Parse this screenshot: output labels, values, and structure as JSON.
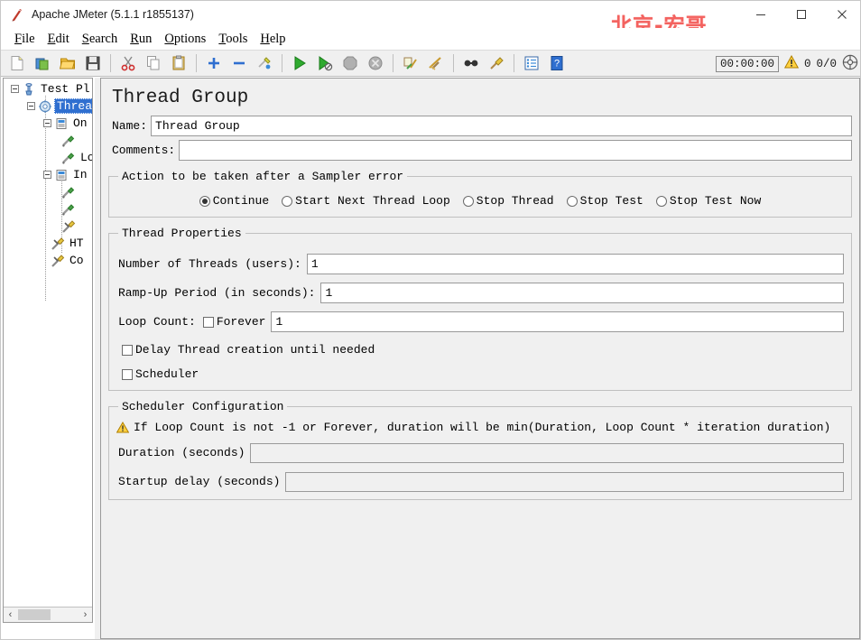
{
  "window": {
    "title": "Apache JMeter (5.1.1 r1855137)",
    "app_icon": "jmeter-feather-icon",
    "watermark": "北京-宏哥",
    "minimize_label": "—",
    "maximize_label": "□",
    "close_label": "✕"
  },
  "menubar": {
    "items": [
      {
        "label": "File",
        "mnemonic": "F"
      },
      {
        "label": "Edit",
        "mnemonic": "E"
      },
      {
        "label": "Search",
        "mnemonic": "S"
      },
      {
        "label": "Run",
        "mnemonic": "R"
      },
      {
        "label": "Options",
        "mnemonic": "O"
      },
      {
        "label": "Tools",
        "mnemonic": "T"
      },
      {
        "label": "Help",
        "mnemonic": "H"
      }
    ]
  },
  "toolbar": {
    "buttons": [
      {
        "name": "new-icon"
      },
      {
        "name": "templates-icon"
      },
      {
        "name": "open-icon"
      },
      {
        "name": "save-icon"
      },
      {
        "name": "separator"
      },
      {
        "name": "cut-icon"
      },
      {
        "name": "copy-icon"
      },
      {
        "name": "paste-icon"
      },
      {
        "name": "separator"
      },
      {
        "name": "expand-all-icon"
      },
      {
        "name": "collapse-all-icon"
      },
      {
        "name": "toggle-icon"
      },
      {
        "name": "separator"
      },
      {
        "name": "start-icon"
      },
      {
        "name": "start-no-pauses-icon"
      },
      {
        "name": "stop-icon"
      },
      {
        "name": "shutdown-icon"
      },
      {
        "name": "separator"
      },
      {
        "name": "clear-icon"
      },
      {
        "name": "clear-all-icon"
      },
      {
        "name": "separator"
      },
      {
        "name": "search-icon"
      },
      {
        "name": "search-reset-icon"
      },
      {
        "name": "separator"
      },
      {
        "name": "function-helper-icon"
      },
      {
        "name": "help-icon"
      }
    ],
    "timer": "00:00:00",
    "warning_count": "0",
    "thread_counts": "0/0",
    "warning_icon": "warning-triangle-icon",
    "reset-icon": "reset-counters-icon"
  },
  "tree": {
    "nodes": [
      {
        "label": "Test Pl",
        "icon": "test-plan-icon",
        "depth": 0,
        "expander": true,
        "selected": false
      },
      {
        "label": "Threa",
        "icon": "thread-group-icon",
        "depth": 1,
        "expander": true,
        "selected": true
      },
      {
        "label": "On",
        "icon": "config-element-icon",
        "depth": 2,
        "expander": true,
        "selected": false
      },
      {
        "label": "",
        "icon": "http-sampler-icon",
        "depth": 3,
        "expander": false,
        "selected": false
      },
      {
        "label": "Lo",
        "icon": "http-sampler-icon",
        "depth": 3,
        "expander": false,
        "selected": false
      },
      {
        "label": "In",
        "icon": "config-element-icon",
        "depth": 2,
        "expander": true,
        "selected": false
      },
      {
        "label": "",
        "icon": "http-sampler-icon",
        "depth": 3,
        "expander": false,
        "selected": false
      },
      {
        "label": "",
        "icon": "http-sampler-icon",
        "depth": 3,
        "expander": false,
        "selected": false
      },
      {
        "label": "",
        "icon": "listener-icon",
        "depth": 3,
        "expander": false,
        "selected": false
      },
      {
        "label": "HT",
        "icon": "listener-icon",
        "depth": 2,
        "expander": false,
        "selected": false
      },
      {
        "label": "Co",
        "icon": "listener-icon",
        "depth": 2,
        "expander": false,
        "selected": false
      }
    ],
    "scrollbar": {
      "left_arrow": "‹",
      "right_arrow": "›"
    }
  },
  "main": {
    "panel_title": "Thread Group",
    "name_label": "Name:",
    "name_value": "Thread Group",
    "comments_label": "Comments:",
    "comments_value": "",
    "sampler_error": {
      "legend": "Action to be taken after a Sampler error",
      "options": [
        {
          "label": "Continue",
          "selected": true
        },
        {
          "label": "Start Next Thread Loop",
          "selected": false
        },
        {
          "label": "Stop Thread",
          "selected": false
        },
        {
          "label": "Stop Test",
          "selected": false
        },
        {
          "label": "Stop Test Now",
          "selected": false
        }
      ]
    },
    "thread_properties": {
      "legend": "Thread Properties",
      "num_threads_label": "Number of Threads (users):",
      "num_threads_value": "1",
      "rampup_label": "Ramp-Up Period (in seconds):",
      "rampup_value": "1",
      "loop_count_label": "Loop Count:",
      "forever_label": "Forever",
      "forever_checked": false,
      "loop_count_value": "1",
      "delay_label": "Delay Thread creation until needed",
      "delay_checked": false,
      "scheduler_label": "Scheduler",
      "scheduler_checked": false
    },
    "scheduler_config": {
      "legend": "Scheduler Configuration",
      "warning_icon": "warning-triangle-icon",
      "warning_text": "If Loop Count is not -1 or Forever, duration will be min(Duration, Loop Count * iteration duration)",
      "duration_label": "Duration (seconds)",
      "duration_value": "",
      "startup_delay_label": "Startup delay (seconds)",
      "startup_delay_value": ""
    }
  },
  "colors": {
    "accent_blue": "#2f6fd0",
    "watermark_red": "#f3625f",
    "panel_bg": "#f0f0f0",
    "field_bg": "#ffffff",
    "border": "#9a9a9a"
  }
}
